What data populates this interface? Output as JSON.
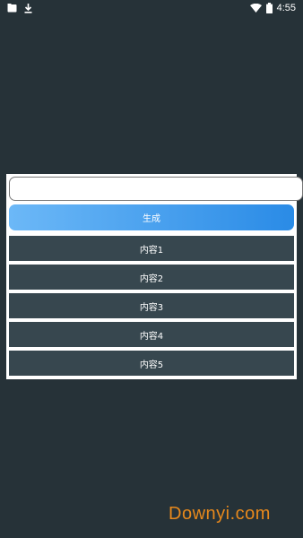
{
  "status_bar": {
    "time": "4:55",
    "icons": [
      "notification-icon",
      "download-icon",
      "wifi-icon",
      "battery-icon"
    ]
  },
  "dialog": {
    "input": {
      "value": "",
      "placeholder": ""
    },
    "generate_button": {
      "label": "生成"
    },
    "items": [
      {
        "label": "内容1"
      },
      {
        "label": "内容2"
      },
      {
        "label": "内容3"
      },
      {
        "label": "内容4"
      },
      {
        "label": "内容5"
      }
    ]
  },
  "watermark": "Downyi.com",
  "colors": {
    "background": "#263238",
    "item_background": "#37474f",
    "button_gradient_start": "#6cb8f7",
    "button_gradient_end": "#2a8be6",
    "watermark": "#e8891c"
  }
}
